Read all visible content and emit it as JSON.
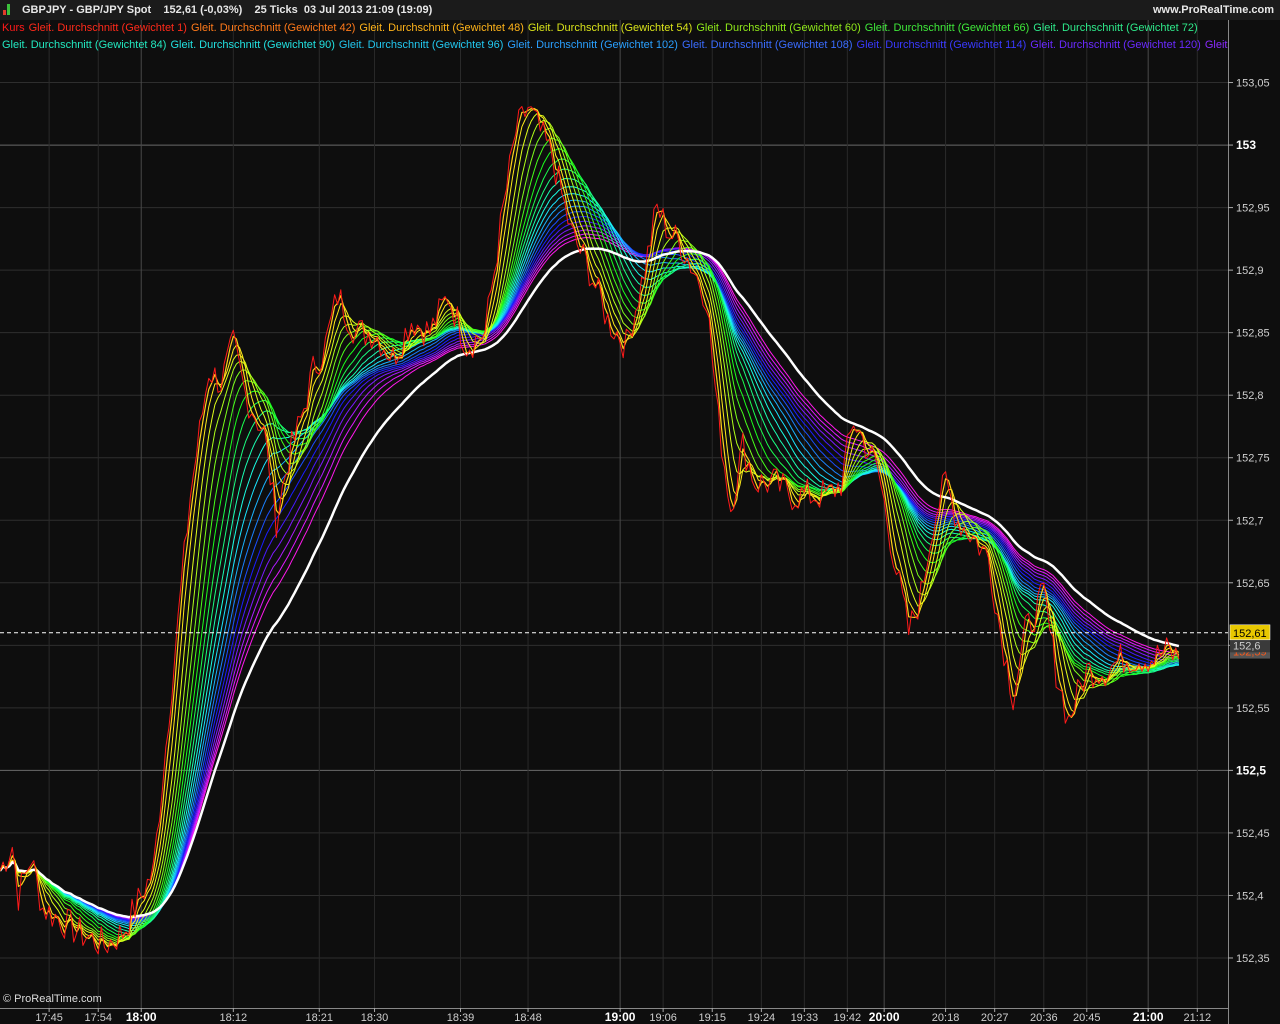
{
  "header": {
    "title": "GBPJPY - GBP/JPY Spot    152,61 (-0,03%)    25 Ticks  03 Jul 2013 21:09 (19:09)",
    "site": "www.ProRealTime.com"
  },
  "watermark": "© ProRealTime.com",
  "legend": {
    "row1": [
      {
        "text": "Kurs",
        "color": "#ff1a1a"
      },
      {
        "text": "Gleit. Durchschnitt (Gewichtet 1)",
        "color": "#ff2a1a"
      },
      {
        "text": "Gleit. Durchschnitt (Gewichtet 42)",
        "color": "#ff7a1a"
      },
      {
        "text": "Gleit. Durchschnitt (Gewichtet 48)",
        "color": "#ffb41a"
      },
      {
        "text": "Gleit. Durchschnitt (Gewichtet 54)",
        "color": "#d8e21a"
      },
      {
        "text": "Gleit. Durchschnitt (Gewichtet 60)",
        "color": "#8fe81a"
      },
      {
        "text": "Gleit. Durchschnitt (Gewichtet 66)",
        "color": "#3fe83a"
      },
      {
        "text": "Gleit. Durchschnitt (Gewichtet 72)",
        "color": "#2ee88a"
      }
    ],
    "row2": [
      {
        "text": "Gleit. Durchschnitt (Gewichtet 84)",
        "color": "#22e8c0"
      },
      {
        "text": "Gleit. Durchschnitt (Gewichtet 90)",
        "color": "#22e0e0"
      },
      {
        "text": "Gleit. Durchschnitt (Gewichtet 96)",
        "color": "#22c8f0"
      },
      {
        "text": "Gleit. Durchschnitt (Gewichtet 102)",
        "color": "#2aa0ff"
      },
      {
        "text": "Gleit. Durchschnitt (Gewichtet 108)",
        "color": "#3a6cff"
      },
      {
        "text": "Gleit. Durchschnitt (Gewichtet 114)",
        "color": "#3a3aff"
      },
      {
        "text": "Gleit. Durchschnitt (Gewichtet 120)",
        "color": "#6a2aff"
      },
      {
        "text": "Gleit. D",
        "color": "#8a2aff"
      }
    ]
  },
  "chart_data": {
    "type": "line",
    "title": "GBPJPY - GBP/JPY Spot",
    "ylim": [
      152.31,
      153.1
    ],
    "y_ticks": [
      {
        "value": 153.05,
        "label": "153,05",
        "major": false
      },
      {
        "value": 153.0,
        "label": "153",
        "major": true
      },
      {
        "value": 152.95,
        "label": "152,95",
        "major": false
      },
      {
        "value": 152.9,
        "label": "152,9",
        "major": false
      },
      {
        "value": 152.85,
        "label": "152,85",
        "major": false
      },
      {
        "value": 152.8,
        "label": "152,8",
        "major": false
      },
      {
        "value": 152.75,
        "label": "152,75",
        "major": false
      },
      {
        "value": 152.7,
        "label": "152,7",
        "major": false
      },
      {
        "value": 152.65,
        "label": "152,65",
        "major": false
      },
      {
        "value": 152.6,
        "label": "152,6",
        "major": false
      },
      {
        "value": 152.55,
        "label": "152,55",
        "major": false
      },
      {
        "value": 152.5,
        "label": "152,5",
        "major": true
      },
      {
        "value": 152.45,
        "label": "152,45",
        "major": false
      },
      {
        "value": 152.4,
        "label": "152,4",
        "major": false
      },
      {
        "value": 152.35,
        "label": "152,35",
        "major": false
      }
    ],
    "x_ticks": [
      {
        "label": "17:45",
        "index": 8,
        "major": false
      },
      {
        "label": "17:54",
        "index": 16,
        "major": false
      },
      {
        "label": "18:00",
        "index": 23,
        "major": true
      },
      {
        "label": "18:12",
        "index": 38,
        "major": false
      },
      {
        "label": "18:21",
        "index": 52,
        "major": false
      },
      {
        "label": "18:30",
        "index": 61,
        "major": false
      },
      {
        "label": "18:39",
        "index": 75,
        "major": false
      },
      {
        "label": "18:48",
        "index": 86,
        "major": false
      },
      {
        "label": "19:00",
        "index": 101,
        "major": true
      },
      {
        "label": "19:06",
        "index": 108,
        "major": false
      },
      {
        "label": "19:15",
        "index": 116,
        "major": false
      },
      {
        "label": "19:24",
        "index": 124,
        "major": false
      },
      {
        "label": "19:33",
        "index": 131,
        "major": false
      },
      {
        "label": "19:42",
        "index": 138,
        "major": false
      },
      {
        "label": "20:00",
        "index": 144,
        "major": true
      },
      {
        "label": "20:18",
        "index": 154,
        "major": false
      },
      {
        "label": "20:27",
        "index": 162,
        "major": false
      },
      {
        "label": "20:36",
        "index": 170,
        "major": false
      },
      {
        "label": "20:45",
        "index": 177,
        "major": false
      },
      {
        "label": "21:00",
        "index": 187,
        "major": true
      },
      {
        "label": "21:12",
        "index": 195,
        "major": false
      }
    ],
    "x_count": 200,
    "last_index": 192,
    "current_price": {
      "value": 152.61,
      "label": "152,61",
      "bg": "#e8c800",
      "fg": "#000000"
    },
    "price_tags": [
      {
        "value": 152.595,
        "label": "152,59",
        "bg": "#555555",
        "fg": "#ff5a1a"
      },
      {
        "value": 152.6,
        "label": "152,6",
        "bg": "#3a3a3a",
        "fg": "#cccccc"
      }
    ],
    "price_series": {
      "name": "Kurs",
      "color": "#ff1a1a",
      "anchors": [
        [
          0,
          152.42
        ],
        [
          2,
          152.44
        ],
        [
          3,
          152.4
        ],
        [
          5,
          152.43
        ],
        [
          7,
          152.39
        ],
        [
          10,
          152.38
        ],
        [
          13,
          152.37
        ],
        [
          17,
          152.36
        ],
        [
          20,
          152.37
        ],
        [
          22,
          152.39
        ],
        [
          25,
          152.42
        ],
        [
          27,
          152.52
        ],
        [
          29,
          152.62
        ],
        [
          31,
          152.72
        ],
        [
          34,
          152.82
        ],
        [
          36,
          152.81
        ],
        [
          38,
          152.84
        ],
        [
          40,
          152.8
        ],
        [
          43,
          152.77
        ],
        [
          45,
          152.7
        ],
        [
          47,
          152.75
        ],
        [
          49,
          152.78
        ],
        [
          51,
          152.82
        ],
        [
          53,
          152.84
        ],
        [
          55,
          152.88
        ],
        [
          58,
          152.85
        ],
        [
          61,
          152.85
        ],
        [
          64,
          152.83
        ],
        [
          67,
          152.86
        ],
        [
          70,
          152.85
        ],
        [
          73,
          152.88
        ],
        [
          76,
          152.84
        ],
        [
          79,
          152.85
        ],
        [
          82,
          152.95
        ],
        [
          84,
          153.01
        ],
        [
          86,
          153.03
        ],
        [
          88,
          153.01
        ],
        [
          90,
          152.99
        ],
        [
          93,
          152.93
        ],
        [
          96,
          152.9
        ],
        [
          99,
          152.86
        ],
        [
          102,
          152.84
        ],
        [
          105,
          152.9
        ],
        [
          107,
          152.95
        ],
        [
          109,
          152.93
        ],
        [
          111,
          152.92
        ],
        [
          113,
          152.9
        ],
        [
          115,
          152.88
        ],
        [
          117,
          152.78
        ],
        [
          119,
          152.71
        ],
        [
          121,
          152.76
        ],
        [
          123,
          152.73
        ],
        [
          126,
          152.73
        ],
        [
          129,
          152.72
        ],
        [
          132,
          152.72
        ],
        [
          135,
          152.72
        ],
        [
          137,
          152.73
        ],
        [
          139,
          152.78
        ],
        [
          141,
          152.76
        ],
        [
          143,
          152.74
        ],
        [
          146,
          152.66
        ],
        [
          148,
          152.61
        ],
        [
          150,
          152.64
        ],
        [
          152,
          152.7
        ],
        [
          154,
          152.73
        ],
        [
          156,
          152.7
        ],
        [
          158,
          152.69
        ],
        [
          161,
          152.67
        ],
        [
          163,
          152.61
        ],
        [
          165,
          152.56
        ],
        [
          167,
          152.61
        ],
        [
          170,
          152.64
        ],
        [
          172,
          152.58
        ],
        [
          174,
          152.54
        ],
        [
          177,
          152.58
        ],
        [
          180,
          152.58
        ],
        [
          183,
          152.59
        ],
        [
          186,
          152.59
        ],
        [
          188,
          152.59
        ],
        [
          190,
          152.595
        ],
        [
          192,
          152.59
        ]
      ]
    }
  }
}
